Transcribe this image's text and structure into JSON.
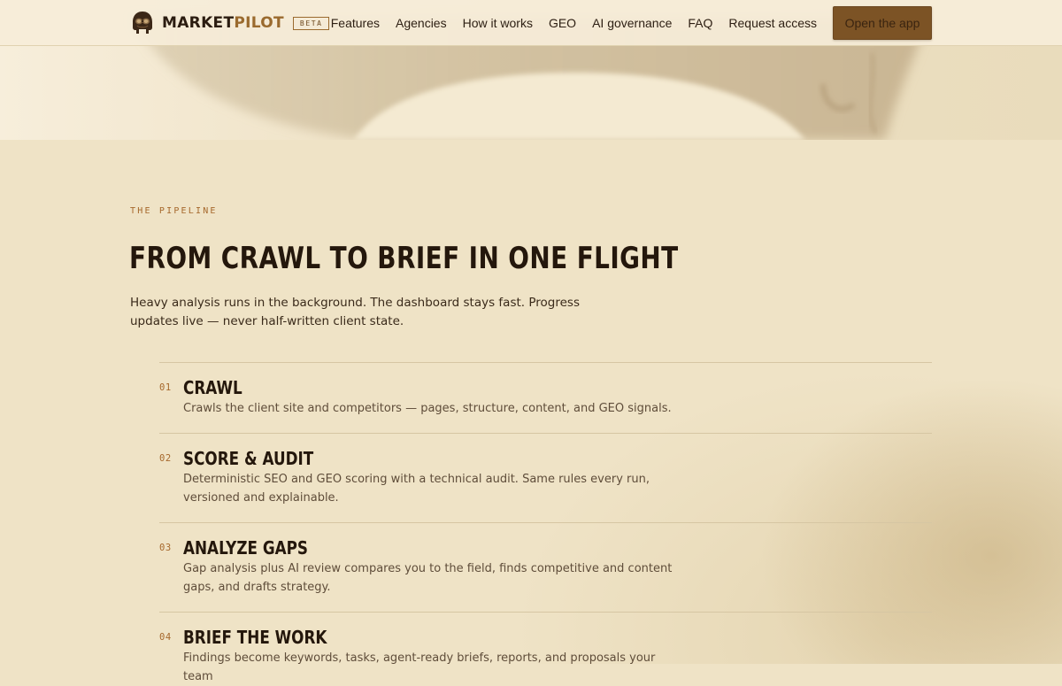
{
  "header": {
    "brand_primary": "MARKET",
    "brand_accent": "PILOT",
    "beta_badge": "BETA",
    "nav": [
      {
        "label": "Features"
      },
      {
        "label": "Agencies"
      },
      {
        "label": "How it works"
      },
      {
        "label": "GEO"
      },
      {
        "label": "AI governance"
      },
      {
        "label": "FAQ"
      },
      {
        "label": "Request access"
      }
    ],
    "cta_label": "Open the app",
    "logo_icon": "aviator-helmet-icon"
  },
  "pipeline": {
    "eyebrow": "THE PIPELINE",
    "headline": "FROM CRAWL TO BRIEF IN ONE FLIGHT",
    "lead": "Heavy analysis runs in the background. The dashboard stays fast. Progress updates live — never half-written client state.",
    "steps": [
      {
        "number": "01",
        "title": "CRAWL",
        "description": "Crawls the client site and competitors — pages, structure, content, and GEO signals."
      },
      {
        "number": "02",
        "title": "SCORE & AUDIT",
        "description": "Deterministic SEO and GEO scoring with a technical audit. Same rules every run, versioned and explainable."
      },
      {
        "number": "03",
        "title": "ANALYZE GAPS",
        "description": "Gap analysis plus AI review compares you to the field, finds competitive and content gaps, and drafts strategy."
      },
      {
        "number": "04",
        "title": "BRIEF THE WORK",
        "description": "Findings become keywords, tasks, agent-ready briefs, reports, and proposals your team"
      }
    ]
  },
  "colors": {
    "accent": "#9a6a2e",
    "cta_background": "#7c5325",
    "page_background": "#efe3c6",
    "heading_text": "#24170c"
  }
}
